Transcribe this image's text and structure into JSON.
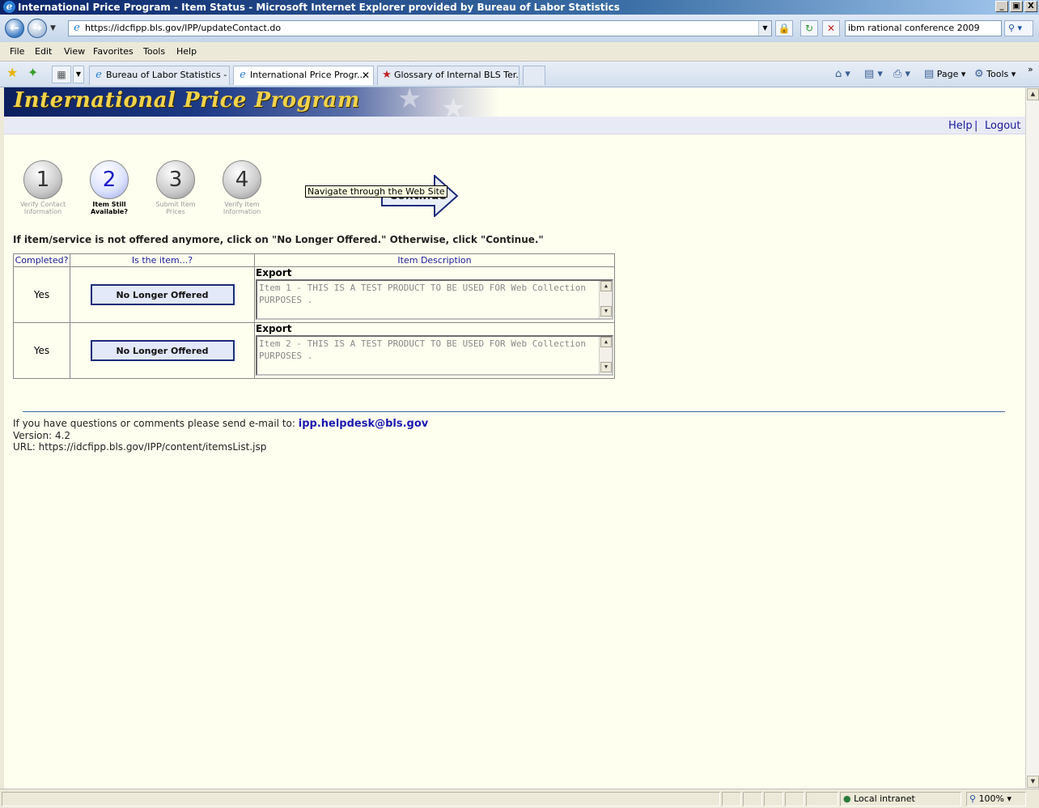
{
  "window": {
    "title": "International Price Program - Item Status - Microsoft Internet Explorer provided by Bureau of Labor Statistics",
    "buttons": [
      "_",
      "▣",
      "X"
    ]
  },
  "address_bar": {
    "url": "https://idcfipp.bls.gov/IPP/updateContact.do",
    "search_value": "ibm rational conference 2009"
  },
  "menu": [
    "File",
    "Edit",
    "View",
    "Favorites",
    "Tools",
    "Help"
  ],
  "tabs": [
    {
      "label": "Bureau of Labor Statistics - I...",
      "active": false
    },
    {
      "label": "International Price Progr...",
      "active": true
    },
    {
      "label": "Glossary of Internal BLS Ter...",
      "active": false
    }
  ],
  "command_bar": {
    "page": "Page",
    "tools": "Tools"
  },
  "banner": {
    "title": "International Price Program"
  },
  "top_links": {
    "help": "Help",
    "separator": "|",
    "logout": "Logout"
  },
  "steps": [
    {
      "number": "1",
      "label": "Verify Contact Information"
    },
    {
      "number": "2",
      "label": "Item Still Available?"
    },
    {
      "number": "3",
      "label": "Submit Item Prices"
    },
    {
      "number": "4",
      "label": "Verify Item Information"
    }
  ],
  "continue": {
    "label": "Continue",
    "tooltip": "Navigate through the Web Site"
  },
  "instruction": "If item/service is not offered anymore, click on \"No Longer Offered.\" Otherwise, click \"Continue.\"",
  "table": {
    "headers": [
      "Completed?",
      "Is the item...?",
      "Item Description"
    ],
    "rows": [
      {
        "completed": "Yes",
        "button": "No Longer Offered",
        "type": "Export",
        "description": "Item 1 - THIS IS A TEST PRODUCT TO BE USED FOR Web Collection PURPOSES ."
      },
      {
        "completed": "Yes",
        "button": "No Longer Offered",
        "type": "Export",
        "description": "Item 2  - THIS IS A TEST PRODUCT TO BE USED FOR Web Collection PURPOSES ."
      }
    ]
  },
  "footer": {
    "question": "If you have questions or comments please send e-mail to:",
    "email": "ipp.helpdesk@bls.gov",
    "version": "Version: 4.2",
    "url": "URL: https://idcfipp.bls.gov/IPP/content/itemsList.jsp"
  },
  "status_bar": {
    "zone": "Local intranet",
    "zoom": "100%"
  }
}
